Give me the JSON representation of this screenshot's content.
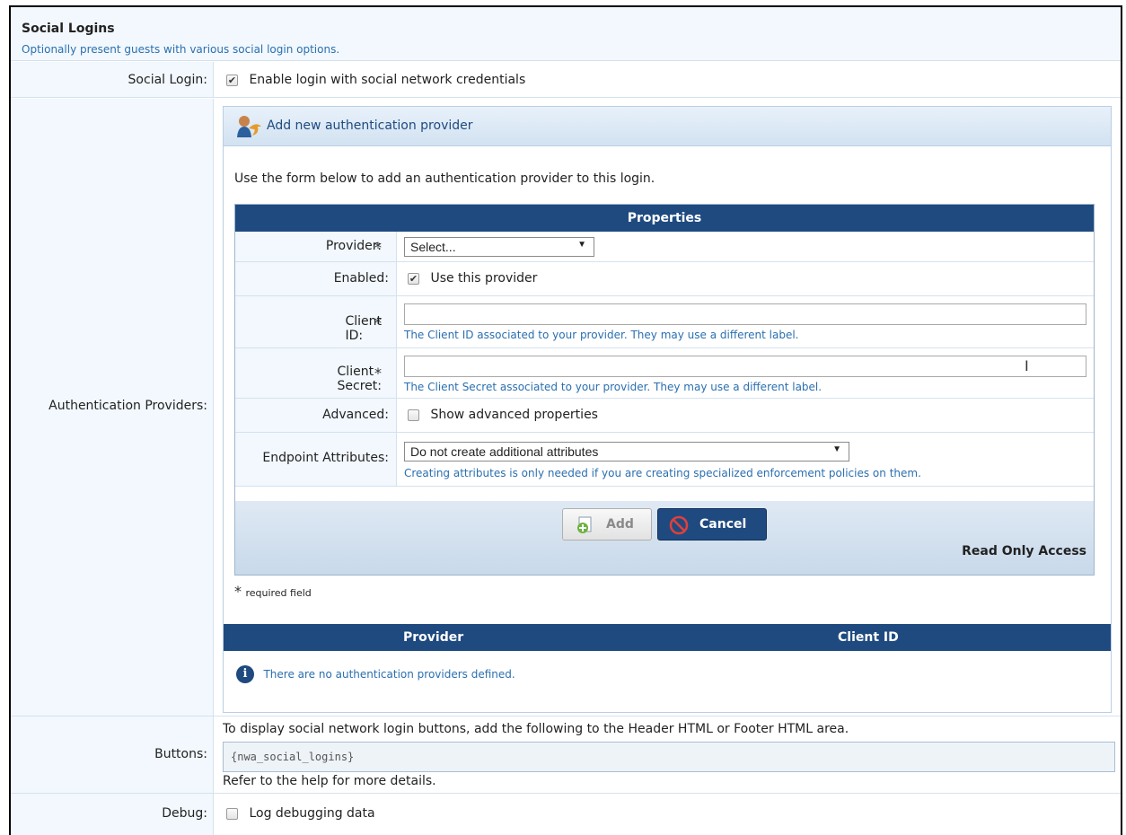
{
  "section": {
    "title": "Social Logins",
    "subtitle": "Optionally present guests with various social login options."
  },
  "social_login": {
    "label": "Social Login:",
    "checkbox_label": "Enable login with social network credentials",
    "checked": true
  },
  "auth_providers": {
    "label": "Authentication Providers:",
    "panel_title": "Add new authentication provider",
    "intro": "Use the form below to add an authentication provider to this login.",
    "properties_title": "Properties",
    "fields": {
      "provider": {
        "label": "Provider:",
        "value": "Select..."
      },
      "enabled": {
        "label": "Enabled:",
        "checkbox_label": "Use this provider",
        "checked": true
      },
      "client_id": {
        "label": "Client ID:",
        "value": "",
        "hint": "The Client ID associated to your provider. They may use a different label."
      },
      "client_secret": {
        "label": "Client Secret:",
        "value": "",
        "hint": "The Client Secret associated to your provider. They may use a different label."
      },
      "advanced": {
        "label": "Advanced:",
        "checkbox_label": "Show advanced properties",
        "checked": false
      },
      "endpoint_attributes": {
        "label": "Endpoint Attributes:",
        "value": "Do not create additional attributes",
        "hint": "Creating attributes is only needed if you are creating specialized enforcement policies on them."
      }
    },
    "buttons": {
      "add": "Add",
      "cancel": "Cancel"
    },
    "read_only": "Read Only Access",
    "required_note": "required field",
    "required_marker": "*",
    "table": {
      "columns": [
        "Provider",
        "Client ID"
      ],
      "empty_message": "There are no authentication providers defined."
    }
  },
  "buttons_row": {
    "label": "Buttons:",
    "description": "To display social network login buttons, add the following to the Header HTML or Footer HTML area.",
    "code": "{nwa_social_logins}",
    "help": "Refer to the help for more details."
  },
  "debug": {
    "label": "Debug:",
    "checkbox_label": "Log debugging data",
    "checked": false
  },
  "colors": {
    "header_blue": "#1f4a80",
    "link_blue": "#2a6fb0",
    "label_bg": "#f2f8fd"
  }
}
